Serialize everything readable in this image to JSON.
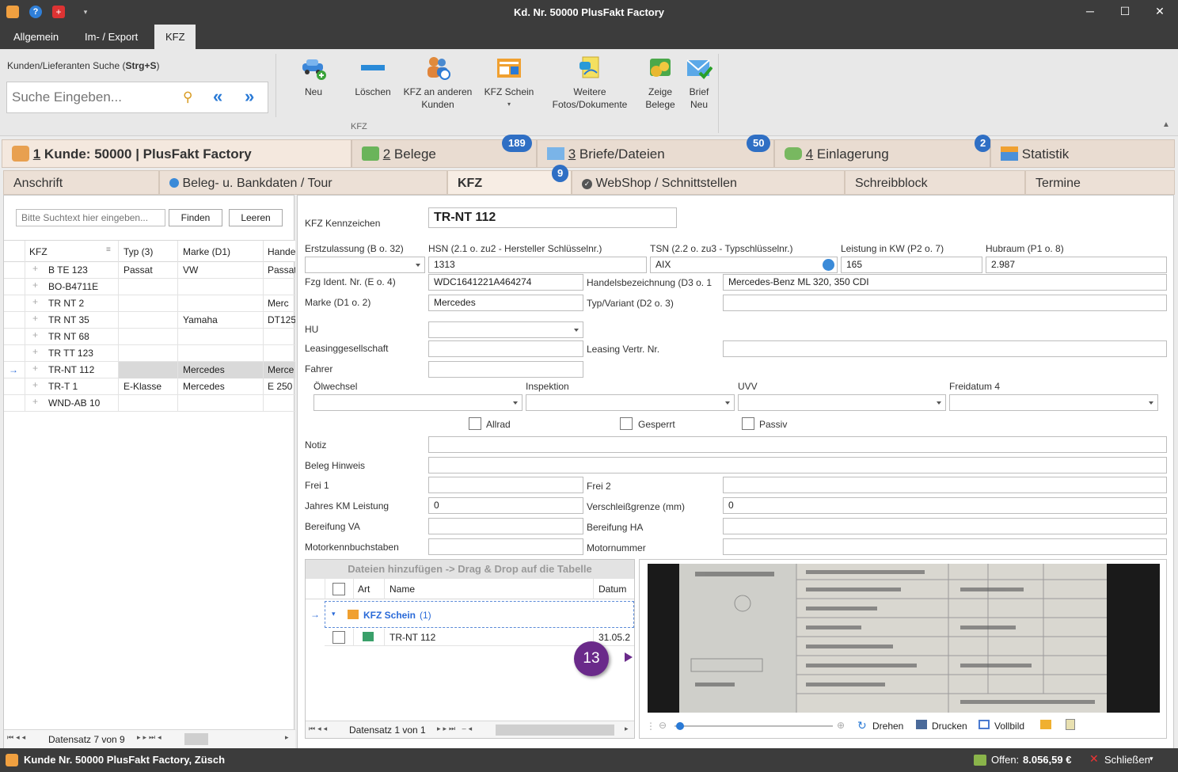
{
  "window": {
    "title": "Kd. Nr. 50000 PlusFakt Factory",
    "min": "─",
    "max": "☐",
    "close": "✕"
  },
  "menu": {
    "items": [
      "Allgemein",
      "Im- / Export",
      "KFZ"
    ]
  },
  "ribbon": {
    "search_label_prefix": "Kunden/Lieferanten Suche (",
    "search_label_shortcut": "Strg+S",
    "search_label_suffix": ")",
    "search_placeholder": "Suche Eingeben...",
    "buttons": [
      "Neu",
      "Löschen",
      "KFZ an anderen\nKunden",
      "KFZ Schein",
      "Weitere\nFotos/Dokumente",
      "Zeige\nBelege",
      "Brief\nNeu"
    ],
    "group_label": "KFZ"
  },
  "main_tabs": [
    {
      "num": "1",
      "label": " Kunde: 50000 | PlusFakt Factory"
    },
    {
      "num": "2",
      "label": " Belege",
      "badge": "189"
    },
    {
      "num": "3",
      "label": " Briefe/Dateien",
      "badge": "50"
    },
    {
      "num": "4",
      "label": " Einlagerung",
      "badge": "2"
    },
    {
      "num": "",
      "label": "Statistik"
    }
  ],
  "sub_tabs": [
    {
      "label": "Anschrift"
    },
    {
      "label": "Beleg- u. Bankdaten / Tour"
    },
    {
      "label": "KFZ",
      "badge": "9"
    },
    {
      "label": "WebShop / Schnittstellen"
    },
    {
      "label": "Schreibblock"
    },
    {
      "label": "Termine"
    }
  ],
  "list": {
    "search_placeholder": "Bitte Suchtext hier eingeben...",
    "find": "Finden",
    "clear": "Leeren",
    "headers": [
      "KFZ",
      "Typ (3)",
      "Marke (D1)",
      "Hande"
    ],
    "rows": [
      [
        "B TE 123",
        "Passat",
        "VW",
        "Passat"
      ],
      [
        "BO-B4711E",
        "",
        "",
        ""
      ],
      [
        "TR NT 2",
        "",
        "",
        "Merc"
      ],
      [
        "TR NT 35",
        "",
        "Yamaha",
        "DT125"
      ],
      [
        "TR NT 68",
        "",
        "",
        ""
      ],
      [
        "TR TT 123",
        "",
        "",
        ""
      ],
      [
        "TR-NT 112",
        "",
        "Mercedes",
        "Merce"
      ],
      [
        "TR-T 1",
        "E-Klasse",
        "Mercedes",
        "E 250"
      ],
      [
        "WND-AB 10",
        "",
        "",
        ""
      ]
    ],
    "footer": "Datensatz 7 von 9"
  },
  "form": {
    "kennzeichen_label": "KFZ Kennzeichen",
    "kennzeichen": "TR-NT 112",
    "erstzulassung_label": "Erstzulassung (B o. 32)",
    "hsn_label": "HSN (2.1 o. zu2 - Hersteller Schlüsselnr.)",
    "hsn": "1313",
    "tsn_label": "TSN (2.2 o. zu3 - Typschlüsselnr.)",
    "tsn": "AIX",
    "leistung_label": "Leistung in KW (P2 o. 7)",
    "leistung": "165",
    "hubraum_label": "Hubraum (P1 o. 8)",
    "hubraum": "2.987",
    "fin_label": "Fzg Ident. Nr. (E o. 4)",
    "fin": "WDC1641221A464274",
    "handel_label": "Handelsbezeichnung (D3 o. 1",
    "handel": "Mercedes-Benz ML 320, 350 CDI",
    "marke_label": "Marke (D1 o. 2)",
    "marke": "Mercedes",
    "typ_label": "Typ/Variant (D2 o. 3)",
    "hu_label": "HU",
    "leasing_label": "Leasinggesellschaft",
    "leasingvertr_label": "Leasing Vertr. Nr.",
    "fahrer_label": "Fahrer",
    "oel_label": "Ölwechsel",
    "insp_label": "Inspektion",
    "uvv_label": "UVV",
    "frei4_label": "Freidatum 4",
    "allrad": "Allrad",
    "gesperrt": "Gesperrt",
    "passiv": "Passiv",
    "notiz_label": "Notiz",
    "beleghinweis_label": "Beleg Hinweis",
    "frei1_label": "Frei 1",
    "frei2_label": "Frei 2",
    "km_label": "Jahres KM Leistung",
    "km": "0",
    "verschleiss_label": "Verschleißgrenze (mm)",
    "verschleiss": "0",
    "bereifung_va_label": "Bereifung VA",
    "bereifung_ha_label": "Bereifung HA",
    "motorkb_label": "Motorkennbuchstaben",
    "motornr_label": "Motornummer"
  },
  "files": {
    "drop_hint": "Dateien hinzufügen -> Drag & Drop auf die Tabelle",
    "headers": [
      "Art",
      "Name",
      "Datum"
    ],
    "group": "KFZ Schein",
    "group_count": "(1)",
    "row_name": "TR-NT 112",
    "row_date": "31.05.2",
    "footer": "Datensatz 1 von 1",
    "callout": "13"
  },
  "image_toolbar": [
    "Drehen",
    "Drucken",
    "Vollbild"
  ],
  "status": {
    "customer": "Kunde Nr. 50000 PlusFakt Factory, Züsch",
    "offen_label": "Offen:",
    "offen_value": "8.056,59 €",
    "close": "Schließen"
  }
}
